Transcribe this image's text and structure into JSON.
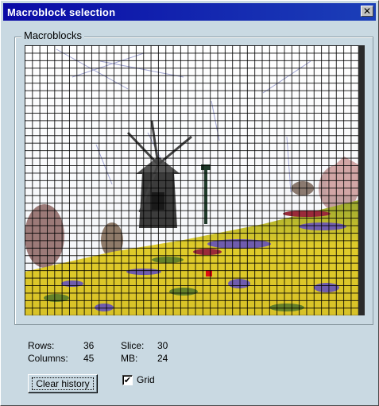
{
  "window": {
    "title": "Macroblock selection"
  },
  "group": {
    "label": "Macroblocks"
  },
  "stats": {
    "rows_label": "Rows:",
    "rows_value": "36",
    "columns_label": "Columns:",
    "columns_value": "45",
    "slice_label": "Slice:",
    "slice_value": "30",
    "mb_label": "MB:",
    "mb_value": "24"
  },
  "buttons": {
    "clear_history": "Clear history"
  },
  "grid_checkbox": {
    "label": "Grid",
    "checked": true,
    "mark": "✔"
  },
  "colors": {
    "titlebar": "#0a0aa6",
    "dialog_bg": "#c9d9e2",
    "selected_macroblock": "#e01010"
  },
  "icons": {
    "close": "close-icon"
  }
}
